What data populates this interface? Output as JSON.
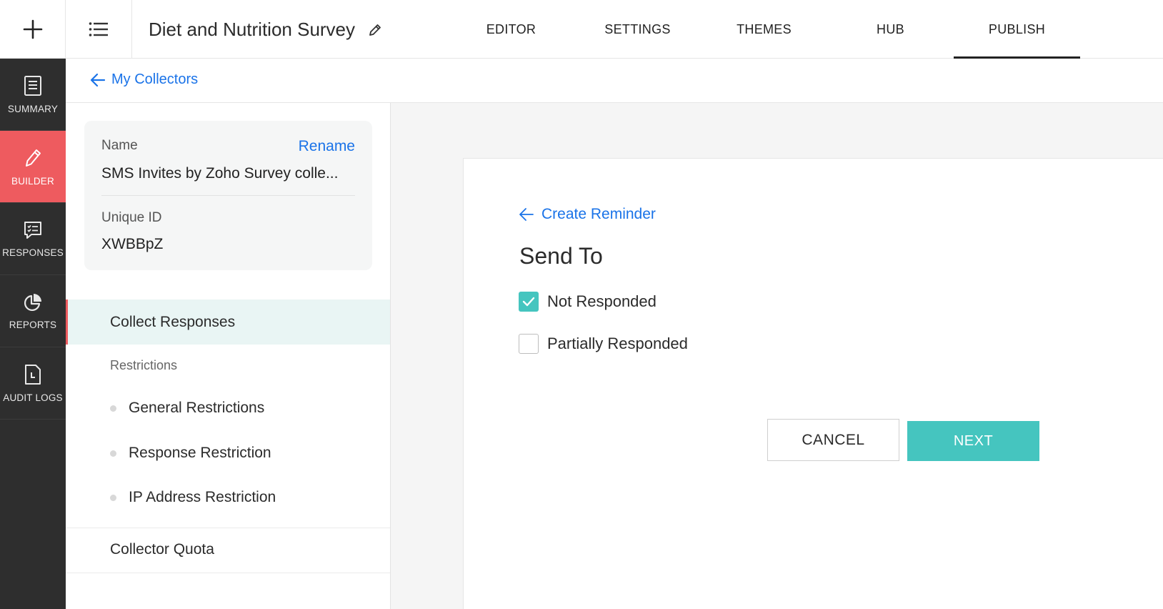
{
  "header": {
    "title": "Diet and Nutrition Survey",
    "tabs": [
      {
        "label": "EDITOR"
      },
      {
        "label": "SETTINGS"
      },
      {
        "label": "THEMES"
      },
      {
        "label": "HUB"
      },
      {
        "label": "PUBLISH",
        "active": true
      }
    ]
  },
  "sidebar": {
    "items": [
      {
        "label": "SUMMARY",
        "icon": "document-icon"
      },
      {
        "label": "BUILDER",
        "icon": "pencil-icon",
        "active": true
      },
      {
        "label": "RESPONSES",
        "icon": "chat-list-icon"
      },
      {
        "label": "REPORTS",
        "icon": "pie-chart-icon"
      },
      {
        "label": "AUDIT LOGS",
        "icon": "log-file-icon"
      }
    ]
  },
  "breadcrumb": {
    "back_label": "My Collectors"
  },
  "collector": {
    "name_label": "Name",
    "rename_label": "Rename",
    "name_value": "SMS Invites by Zoho Survey colle...",
    "id_label": "Unique ID",
    "id_value": "XWBBpZ"
  },
  "left_nav": {
    "collect_responses": "Collect Responses",
    "restrictions_heading": "Restrictions",
    "restrictions": [
      "General Restrictions",
      "Response Restriction",
      "IP Address Restriction"
    ],
    "collector_quota": "Collector Quota"
  },
  "reminder": {
    "back_label": "Create Reminder",
    "heading": "Send To",
    "options": [
      {
        "label": "Not Responded",
        "checked": true
      },
      {
        "label": "Partially Responded",
        "checked": false
      }
    ],
    "cancel_label": "CANCEL",
    "next_label": "NEXT"
  },
  "colors": {
    "accent_teal": "#45c5bf",
    "active_red": "#ee5b5f",
    "link_blue": "#1a73e8",
    "sidebar_dark": "#2e2e2e"
  }
}
